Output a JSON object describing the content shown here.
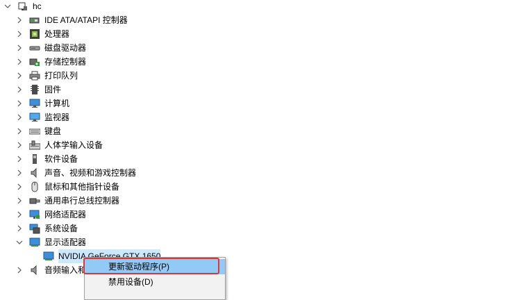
{
  "tree": {
    "root": {
      "label": "hc",
      "icon": "computer-icon"
    },
    "categories": [
      {
        "label": "IDE ATA/ATAPI 控制器",
        "icon": "ide-controller-icon"
      },
      {
        "label": "处理器",
        "icon": "processor-icon"
      },
      {
        "label": "磁盘驱动器",
        "icon": "disk-drive-icon"
      },
      {
        "label": "存储控制器",
        "icon": "storage-controller-icon"
      },
      {
        "label": "打印队列",
        "icon": "printer-icon"
      },
      {
        "label": "固件",
        "icon": "firmware-icon"
      },
      {
        "label": "计算机",
        "icon": "computer-monitor-icon"
      },
      {
        "label": "监视器",
        "icon": "monitor-icon"
      },
      {
        "label": "键盘",
        "icon": "keyboard-icon"
      },
      {
        "label": "人体学输入设备",
        "icon": "hid-icon"
      },
      {
        "label": "软件设备",
        "icon": "software-device-icon"
      },
      {
        "label": "声音、视频和游戏控制器",
        "icon": "speaker-icon"
      },
      {
        "label": "鼠标和其他指针设备",
        "icon": "mouse-icon"
      },
      {
        "label": "通用串行总线控制器",
        "icon": "usb-icon"
      },
      {
        "label": "网络适配器",
        "icon": "network-adapter-icon"
      },
      {
        "label": "系统设备",
        "icon": "system-device-icon"
      },
      {
        "label": "显示适配器",
        "icon": "display-adapter-icon",
        "expanded": true
      }
    ],
    "display_child": {
      "label": "NVIDIA GeForce GTX 1650",
      "icon": "display-adapter-icon"
    },
    "audio_partial": {
      "label": "音频输入和",
      "icon": "speaker-icon"
    }
  },
  "context_menu": {
    "items": [
      {
        "label": "更新驱动程序(P)"
      },
      {
        "label": "禁用设备(D)"
      }
    ]
  },
  "colors": {
    "menu_hover": "#91c9f7",
    "highlight_border": "#e03333",
    "selection": "#cce8ff"
  }
}
